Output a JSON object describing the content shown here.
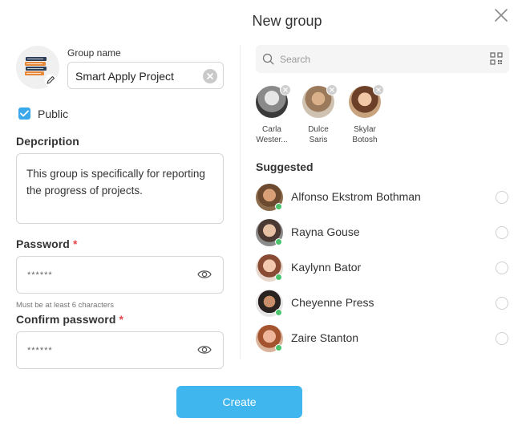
{
  "dialog": {
    "title": "New group"
  },
  "group": {
    "name_label": "Group name",
    "name_value": "Smart Apply Project",
    "public_label": "Public",
    "public_checked": true
  },
  "description": {
    "label": "Depcription",
    "value": "This group is specifically for reporting the progress of projects."
  },
  "password": {
    "label": "Password",
    "required_mark": "*",
    "mask": "******",
    "hint": "Must be at least 6 characters"
  },
  "confirm_password": {
    "label": "Confirm password",
    "required_mark": "*",
    "mask": "******"
  },
  "actions": {
    "create_label": "Create"
  },
  "search": {
    "placeholder": "Search"
  },
  "selected_users": [
    {
      "first": "Carla",
      "last": "Wester..."
    },
    {
      "first": "Dulce",
      "last": "Saris"
    },
    {
      "first": "Skylar",
      "last": "Botosh"
    }
  ],
  "suggested": {
    "title": "Suggested",
    "users": [
      {
        "name": "Alfonso Ekstrom Bothman",
        "online": true
      },
      {
        "name": "Rayna Gouse",
        "online": true
      },
      {
        "name": "Kaylynn Bator",
        "online": true
      },
      {
        "name": "Cheyenne Press",
        "online": true
      },
      {
        "name": "Zaire Stanton",
        "online": true
      }
    ]
  },
  "colors": {
    "accent": "#40b6ee",
    "checkbox": "#3aa8ea",
    "online": "#4bc26c",
    "required": "#e5484d"
  },
  "icons": [
    "close-icon",
    "group-book-icon",
    "edit-pencil-icon",
    "clear-icon",
    "check-icon",
    "eye-icon",
    "search-icon",
    "qr-code-icon",
    "remove-icon"
  ]
}
